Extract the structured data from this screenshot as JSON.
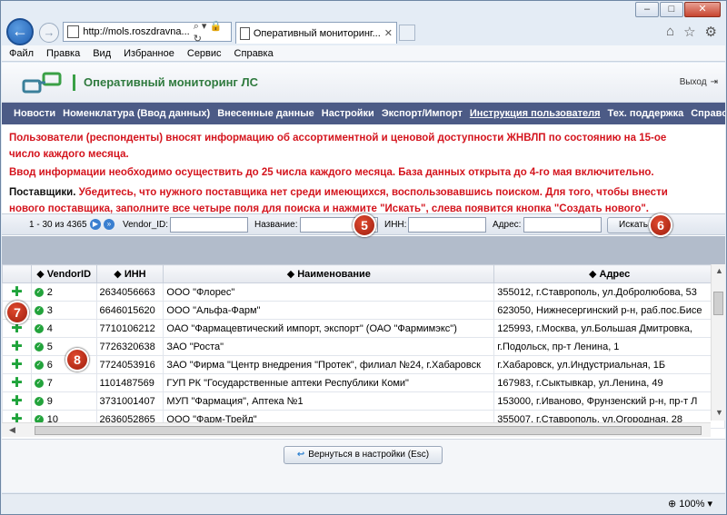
{
  "browser": {
    "address": "http://mols.roszdravna...",
    "tab_title": "Оперативный мониторинг...",
    "zoom": "100%"
  },
  "menubar": [
    "Файл",
    "Правка",
    "Вид",
    "Избранное",
    "Сервис",
    "Справка"
  ],
  "header": {
    "title": "Оперативный мониторинг ЛС",
    "exit_label": "Выход"
  },
  "topnav": [
    "Новости",
    "Номенклатура (Ввод данных)",
    "Внесенные данные",
    "Настройки",
    "Экспорт/Импорт",
    "Инструкция пользователя",
    "Тех. поддержка",
    "Справочни"
  ],
  "notice": {
    "line1": "Пользователи (респонденты) вносят информацию об ассортиментной и ценовой доступности ЖНВЛП по состоянию на 15-ое",
    "line2": "число каждого месяца.",
    "line3": "Ввод информации необходимо осуществить до 25 числа каждого месяца. База данных открыта до 4-го мая включительно.",
    "line4_label": "Поставщики.",
    "line4": " Убедитесь, что нужного поставщика нет среди имеющихся, воспользовавшись поиском. Для того, чтобы внести",
    "line5": "нового поставщика, заполните все четыре поля для поиска и нажмите \"Искать\", слева появится кнопка \"Создать нового\"."
  },
  "filter": {
    "range": "1 - 30 из 4365",
    "vendor_label": "Vendor_ID:",
    "name_label": "Название:",
    "inn_label": "ИНН:",
    "address_label": "Адрес:",
    "search_button": "Искать"
  },
  "table": {
    "headers": [
      "VendorID",
      "ИНН",
      "Наименование",
      "Адрес"
    ],
    "rows": [
      {
        "id": "2",
        "inn": "2634056663",
        "name": "ООО \"Флорес\"",
        "address": "355012, г.Ставрополь, ул.Добролюбова, 53"
      },
      {
        "id": "3",
        "inn": "6646015620",
        "name": "ООО \"Альфа-Фарм\"",
        "address": "623050, Нижнесергинский р-н, раб.пос.Бисе"
      },
      {
        "id": "4",
        "inn": "7710106212",
        "name": "ОАО \"Фармацевтический импорт, экспорт\" (ОАО \"Фармимэкс\")",
        "address": "125993, г.Москва, ул.Большая Дмитровка,"
      },
      {
        "id": "5",
        "inn": "7726320638",
        "name": "ЗАО \"Роста\"",
        "address": "г.Подольск, пр-т Ленина, 1"
      },
      {
        "id": "6",
        "inn": "7724053916",
        "name": "ЗАО \"Фирма \"Центр внедрения \"Протек\", филиал №24, г.Хабаровск",
        "address": "г.Хабаровск, ул.Индустриальная, 1Б"
      },
      {
        "id": "7",
        "inn": "1101487569",
        "name": "ГУП РК \"Государственные аптеки Республики Коми\"",
        "address": "167983, г.Сыктывкар, ул.Ленина, 49"
      },
      {
        "id": "9",
        "inn": "3731001407",
        "name": "МУП \"Фармация\", Аптека №1",
        "address": "153000, г.Иваново, Фрунзенский р-н, пр-т Л"
      },
      {
        "id": "10",
        "inn": "2636052865",
        "name": "ООО \"Фарм-Трейд\"",
        "address": "355007, г.Ставрополь, ул.Огородная, 28"
      }
    ]
  },
  "footer": {
    "return_button": "Вернуться в настройки (Esc)"
  },
  "badges": [
    "5",
    "6",
    "7",
    "8"
  ],
  "colors": {
    "nav_bg": "#4c5b86",
    "notice_red": "#d4141d",
    "accent_green": "#2f7a3e",
    "badge_red": "#c1321b"
  }
}
